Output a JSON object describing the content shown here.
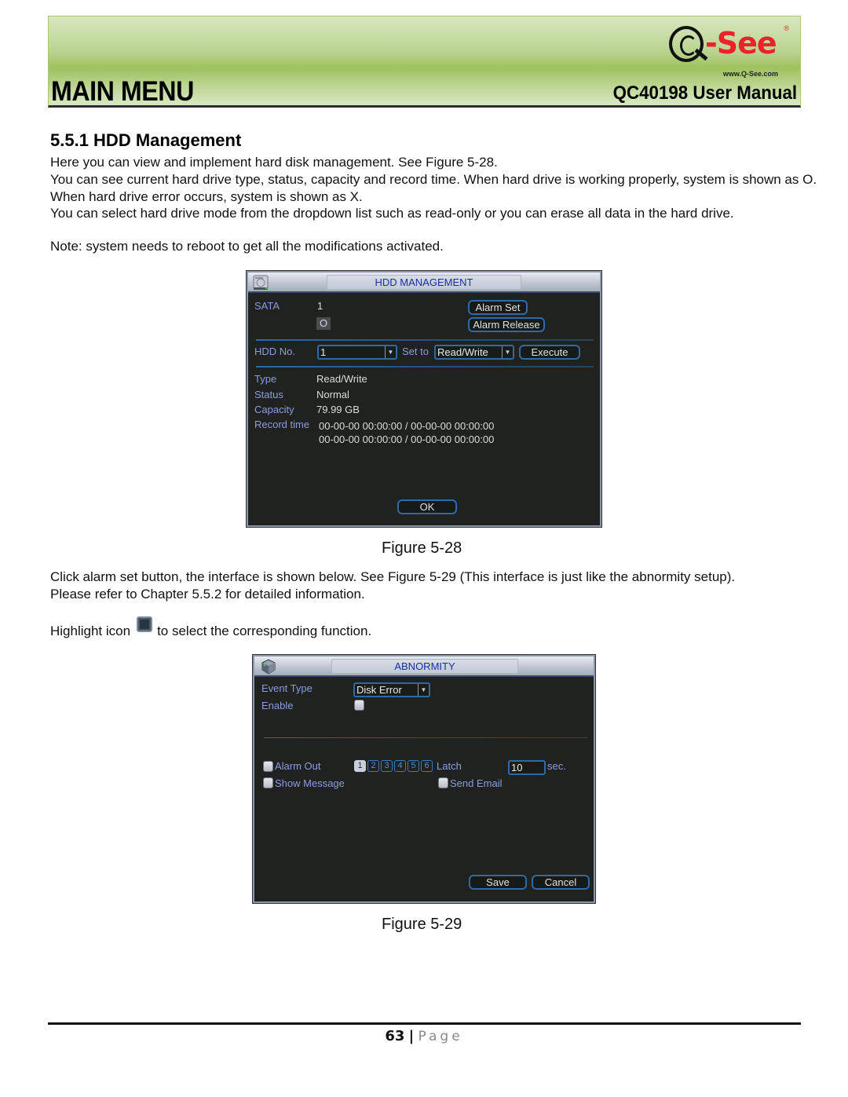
{
  "header": {
    "section": "MAIN MENU",
    "manual_title": "QC40198 User Manual",
    "logo": {
      "brand": "Q-See",
      "registered": "®",
      "url": "www.Q-See.com"
    }
  },
  "content": {
    "section_title": "5.5.1  HDD Management",
    "paragraphs": [
      "Here you can view and implement hard disk management. See Figure 5-28.",
      "You can see current hard drive type, status, capacity and record time. When hard drive is working properly, system is shown as O. When hard drive error occurs, system is shown as X.",
      "You can select hard drive mode from the dropdown list such as read-only or you can erase all data in the hard drive.",
      "Note: system needs to reboot to get all the modifications activated."
    ],
    "paragraph_after_fig28": [
      "Click alarm set button, the interface is shown below. See Figure 5-29 (This interface is just like the abnormity setup).",
      "Please refer to Chapter 5.5.2 for detailed information."
    ],
    "highlight_prefix": "Highlight icon",
    "highlight_suffix": "to select the corresponding function.",
    "highlight_icon": "checkbox-highlight-icon"
  },
  "figure_28": {
    "caption": "Figure 5-28",
    "window_title": "HDD MANAGEMENT",
    "title_icon": "hard-disk-icon",
    "sata_label": "SATA",
    "sata_value": "1",
    "sata_status": "O",
    "alarm_set_button": "Alarm Set",
    "alarm_release_button": "Alarm Release",
    "hdd_no_label": "HDD No.",
    "hdd_no_value": "1",
    "set_to_label": "Set to",
    "set_to_value": "Read/Write",
    "execute_button": "Execute",
    "info": {
      "type_label": "Type",
      "type_value": "Read/Write",
      "status_label": "Status",
      "status_value": "Normal",
      "capacity_label": "Capacity",
      "capacity_value": "79.99 GB",
      "record_time_label": "Record time",
      "record_times": [
        "00-00-00 00:00:00 / 00-00-00 00:00:00",
        "00-00-00 00:00:00 / 00-00-00 00:00:00"
      ]
    },
    "ok_button": "OK"
  },
  "figure_29": {
    "caption": "Figure 5-29",
    "window_title": "ABNORMITY",
    "title_icon": "alarm-cube-icon",
    "event_type_label": "Event Type",
    "event_type_value": "Disk Error",
    "enable_label": "Enable",
    "enable_checked": false,
    "alarm_out_label": "Alarm Out",
    "alarm_out_checked": false,
    "alarm_channels": [
      {
        "label": "1",
        "active": true
      },
      {
        "label": "2",
        "active": false
      },
      {
        "label": "3",
        "active": false
      },
      {
        "label": "4",
        "active": false
      },
      {
        "label": "5",
        "active": false
      },
      {
        "label": "6",
        "active": false
      }
    ],
    "latch_label": "Latch",
    "latch_value": "10",
    "latch_unit": "sec.",
    "show_message_label": "Show Message",
    "show_message_checked": false,
    "send_email_label": "Send Email",
    "send_email_checked": false,
    "save_button": "Save",
    "cancel_button": "Cancel"
  },
  "footer": {
    "page_number": "63",
    "separator": "|",
    "page_word": "Page"
  }
}
